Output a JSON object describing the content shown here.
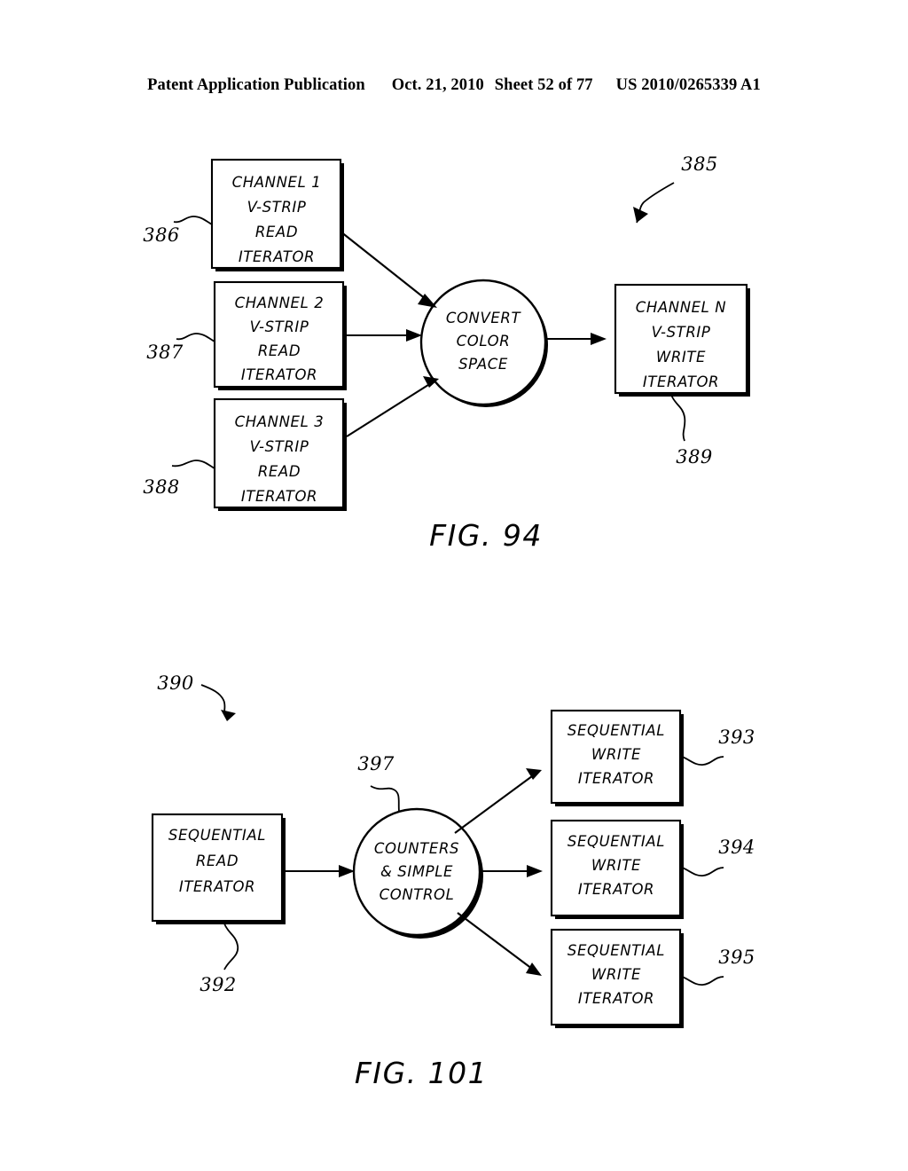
{
  "header": {
    "publication": "Patent Application Publication",
    "date": "Oct. 21, 2010",
    "sheet": "Sheet 52 of 77",
    "patent_number": "US 2010/0265339 A1"
  },
  "figures": [
    {
      "caption": "FIG. 94",
      "diagram_ref": "385",
      "nodes": [
        {
          "id": "ch1",
          "shape": "rect",
          "ref": "386",
          "lines": [
            "CHANNEL 1",
            "V-STRIP",
            "READ",
            "ITERATOR"
          ]
        },
        {
          "id": "ch2",
          "shape": "rect",
          "ref": "387",
          "lines": [
            "CHANNEL 2",
            "V-STRIP",
            "READ",
            "ITERATOR"
          ]
        },
        {
          "id": "ch3",
          "shape": "rect",
          "ref": "388",
          "lines": [
            "CHANNEL 3",
            "V-STRIP",
            "READ",
            "ITERATOR"
          ]
        },
        {
          "id": "convert",
          "shape": "circle",
          "ref": "",
          "lines": [
            "CONVERT",
            "COLOR",
            "SPACE"
          ]
        },
        {
          "id": "chn",
          "shape": "rect",
          "ref": "389",
          "lines": [
            "CHANNEL N",
            "V-STRIP",
            "WRITE",
            "ITERATOR"
          ]
        }
      ],
      "edges": [
        {
          "from": "ch1",
          "to": "convert"
        },
        {
          "from": "ch2",
          "to": "convert"
        },
        {
          "from": "ch3",
          "to": "convert"
        },
        {
          "from": "convert",
          "to": "chn"
        }
      ]
    },
    {
      "caption": "FIG. 101",
      "diagram_ref": "390",
      "nodes": [
        {
          "id": "seqread",
          "shape": "rect",
          "ref": "392",
          "lines": [
            "SEQUENTIAL",
            "READ",
            "ITERATOR"
          ]
        },
        {
          "id": "counters",
          "shape": "circle",
          "ref": "397",
          "lines": [
            "COUNTERS",
            "& SIMPLE",
            "CONTROL"
          ]
        },
        {
          "id": "seqwrite1",
          "shape": "rect",
          "ref": "393",
          "lines": [
            "SEQUENTIAL",
            "WRITE",
            "ITERATOR"
          ]
        },
        {
          "id": "seqwrite2",
          "shape": "rect",
          "ref": "394",
          "lines": [
            "SEQUENTIAL",
            "WRITE",
            "ITERATOR"
          ]
        },
        {
          "id": "seqwrite3",
          "shape": "rect",
          "ref": "395",
          "lines": [
            "SEQUENTIAL",
            "WRITE",
            "ITERATOR"
          ]
        }
      ],
      "edges": [
        {
          "from": "seqread",
          "to": "counters"
        },
        {
          "from": "counters",
          "to": "seqwrite1"
        },
        {
          "from": "counters",
          "to": "seqwrite2"
        },
        {
          "from": "counters",
          "to": "seqwrite3"
        }
      ]
    }
  ],
  "colors": {
    "ink": "#000000",
    "paper": "#ffffff"
  }
}
